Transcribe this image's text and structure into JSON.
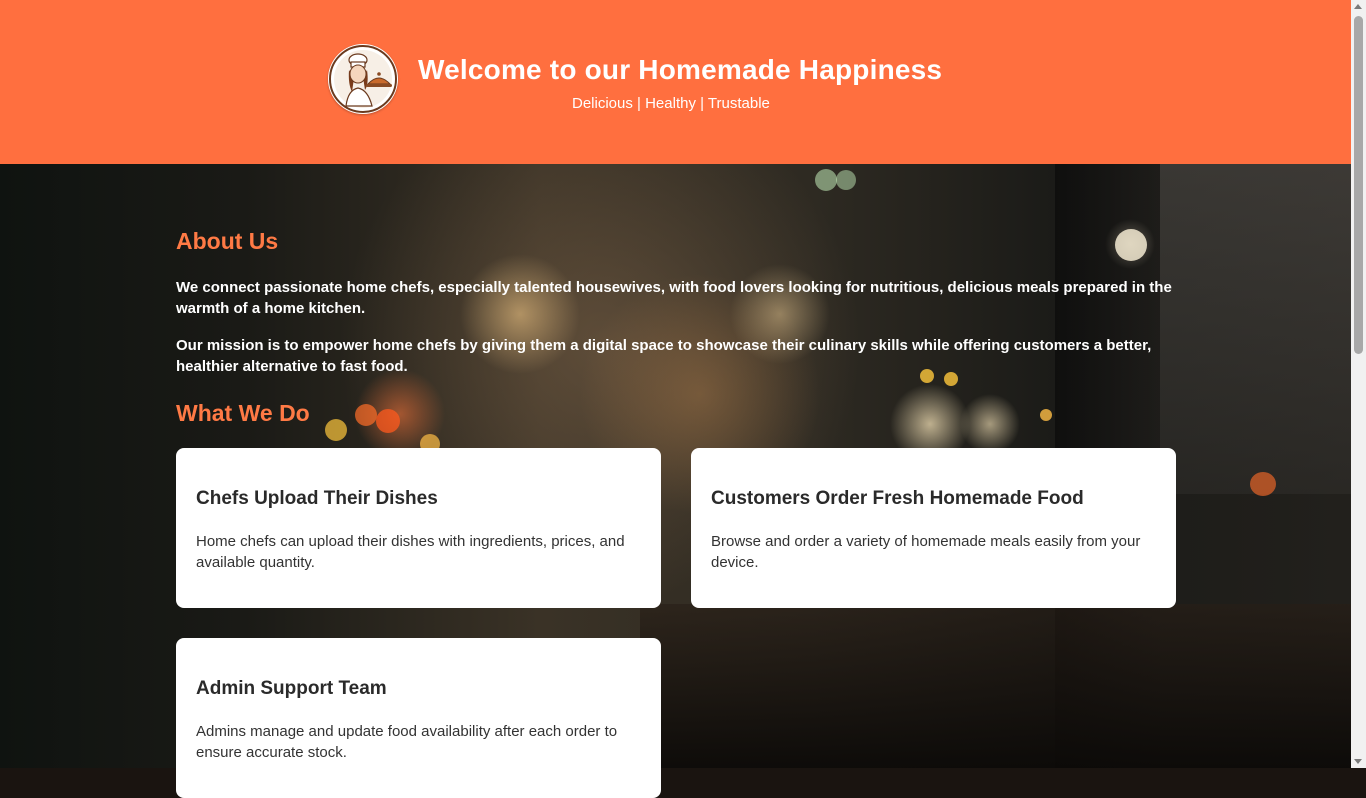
{
  "header": {
    "title": "Welcome to our Homemade Happiness",
    "tagline": "Delicious | Healthy | Trustable",
    "logo_icon": "chef-woman-logo-icon"
  },
  "about": {
    "heading": "About Us",
    "paragraph_1": "We connect passionate home chefs, especially talented housewives, with food lovers looking for nutritious, delicious meals prepared in the warmth of a home kitchen.",
    "paragraph_2": "Our mission is to empower home chefs by giving them a digital space to showcase their culinary skills while offering customers a better, healthier alternative to fast food."
  },
  "what_we_do": {
    "heading": "What We Do",
    "cards": [
      {
        "title": "Chefs Upload Their Dishes",
        "text": "Home chefs can upload their dishes with ingredients, prices, and available quantity."
      },
      {
        "title": "Customers Order Fresh Homemade Food",
        "text": "Browse and order a variety of homemade meals easily from your device."
      },
      {
        "title": "Admin Support Team",
        "text": "Admins manage and update food availability after each order to ensure accurate stock."
      }
    ]
  },
  "colors": {
    "header_bg": "#ff6f3f",
    "accent_heading": "#ff7a45",
    "card_bg": "#ffffff"
  }
}
